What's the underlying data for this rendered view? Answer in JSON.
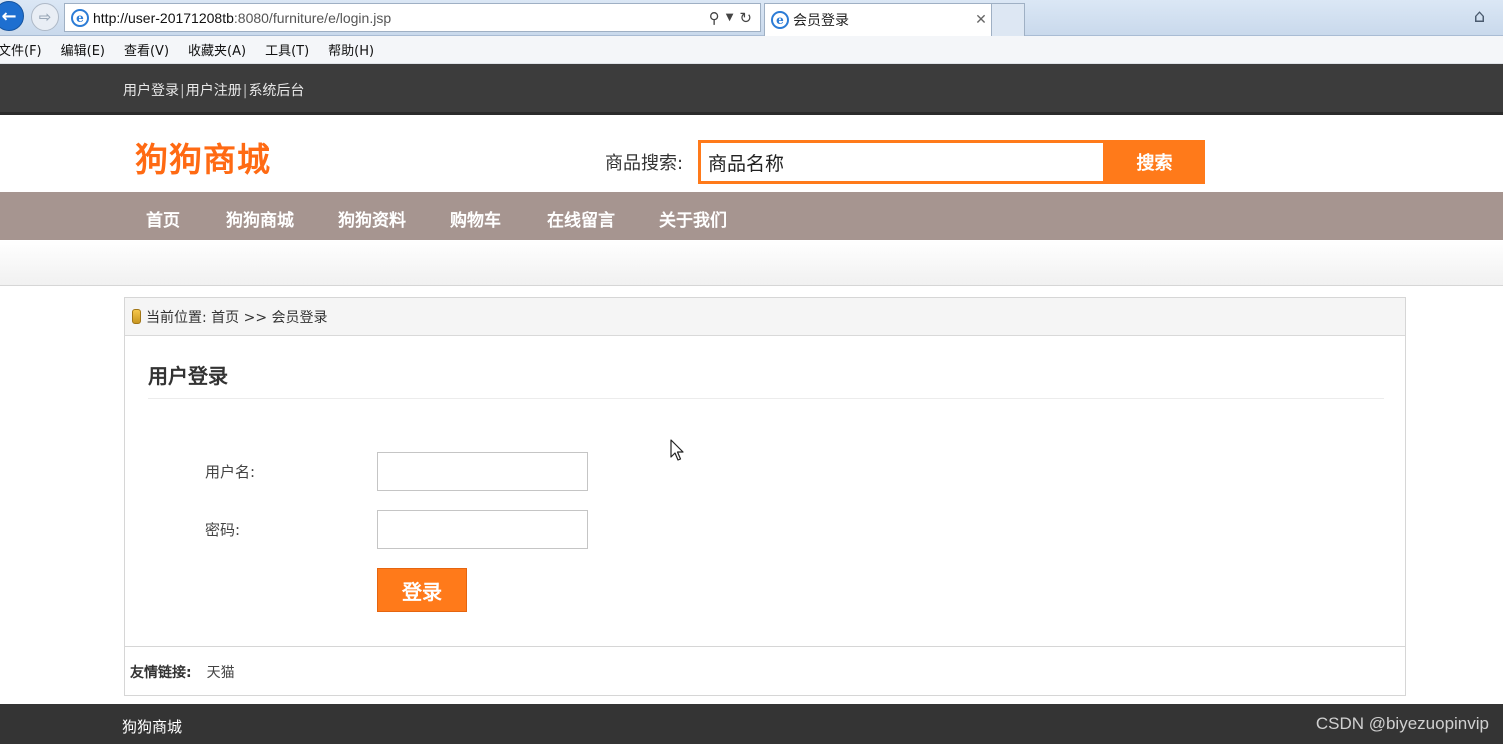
{
  "browser": {
    "url_host": "http://user-20171208tb",
    "url_path": ":8080/furniture/e/login.jsp",
    "tab_title": "会员登录",
    "menu": [
      "文件(F)",
      "编辑(E)",
      "查看(V)",
      "收藏夹(A)",
      "工具(T)",
      "帮助(H)"
    ]
  },
  "topbar": {
    "links": [
      "用户登录",
      "用户注册",
      "系统后台"
    ],
    "separator": "|"
  },
  "header": {
    "logo": "狗狗商城",
    "search_label": "商品搜索:",
    "search_value": "商品名称",
    "search_button": "搜索"
  },
  "nav": {
    "items": [
      "首页",
      "狗狗商城",
      "狗狗资料",
      "购物车",
      "在线留言",
      "关于我们"
    ]
  },
  "breadcrumb": "当前位置: 首页 >> 会员登录",
  "login": {
    "title": "用户登录",
    "username_label": "用户名:",
    "password_label": "密码:",
    "username_value": "",
    "password_value": "",
    "submit": "登录"
  },
  "friend_links": {
    "label": "友情链接:",
    "items": [
      "天猫"
    ]
  },
  "footer": {
    "name": "狗狗商城",
    "watermark": "CSDN @biyezuopinvip"
  },
  "colors": {
    "accent": "#ff7a1a",
    "nav_bg": "#a69590",
    "topbar_bg": "#3c3c3c"
  }
}
